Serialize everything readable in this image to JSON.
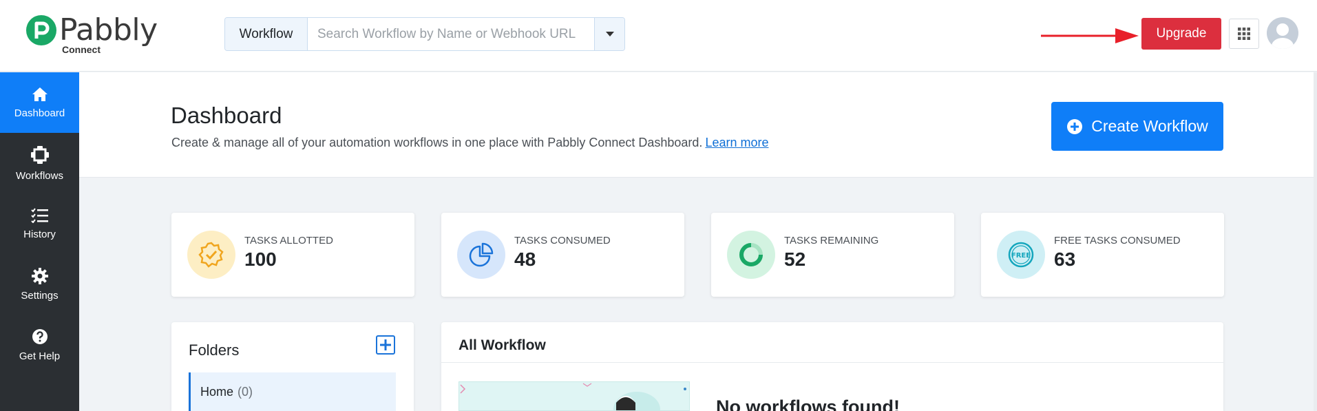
{
  "brand": {
    "name": "Pabbly",
    "sub": "Connect",
    "colors": {
      "primary": "#0f7ef8",
      "danger": "#dc2f3e",
      "sidebar": "#2b2f33",
      "logo_green": "#1aa866"
    }
  },
  "header": {
    "search": {
      "label": "Workflow",
      "placeholder": "Search Workflow by Name or Webhook URL",
      "value": ""
    },
    "upgrade_label": "Upgrade",
    "apps_icon": "grid-icon",
    "avatar_icon": "user-avatar"
  },
  "sidebar": {
    "items": [
      {
        "label": "Dashboard",
        "icon": "home-icon",
        "active": true
      },
      {
        "label": "Workflows",
        "icon": "workflow-icon",
        "active": false
      },
      {
        "label": "History",
        "icon": "history-list-icon",
        "active": false
      },
      {
        "label": "Settings",
        "icon": "gear-icon",
        "active": false
      },
      {
        "label": "Get Help",
        "icon": "help-icon",
        "active": false
      }
    ]
  },
  "page": {
    "title": "Dashboard",
    "description": "Create & manage all of your automation workflows in one place with Pabbly Connect Dashboard.",
    "learn_more": "Learn more",
    "create_button": "Create Workflow"
  },
  "stats": [
    {
      "label": "TASKS ALLOTTED",
      "value": "100",
      "icon": "badge-check-icon",
      "bg": "#fdeec4",
      "fg": "#f0a51e"
    },
    {
      "label": "TASKS CONSUMED",
      "value": "48",
      "icon": "pie-chart-icon",
      "bg": "#d6e6fb",
      "fg": "#1a73d9"
    },
    {
      "label": "TASKS REMAINING",
      "value": "52",
      "icon": "donut-icon",
      "bg": "#d3f3e1",
      "fg": "#1aa866"
    },
    {
      "label": "FREE TASKS CONSUMED",
      "value": "63",
      "icon": "free-badge-icon",
      "bg": "#cfeff5",
      "fg": "#14a6bd"
    }
  ],
  "folders": {
    "title": "Folders",
    "items": [
      {
        "name": "Home",
        "count": "(0)"
      }
    ]
  },
  "workflows": {
    "title": "All Workflow",
    "empty_message": "No workflows found!"
  }
}
